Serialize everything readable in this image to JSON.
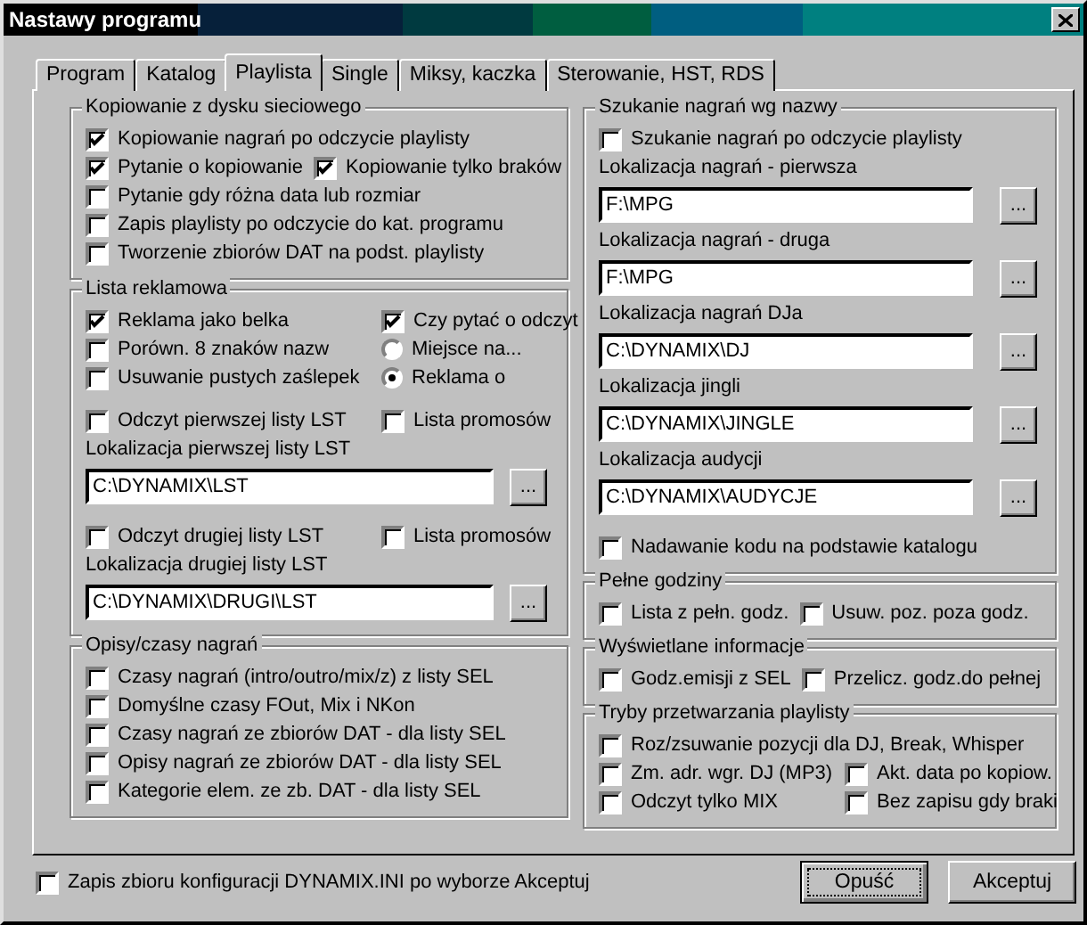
{
  "window": {
    "title": "Nastawy programu"
  },
  "tabs": [
    {
      "label": "Program",
      "selected": false
    },
    {
      "label": "Katalog",
      "selected": false
    },
    {
      "label": "Playlista",
      "selected": true
    },
    {
      "label": "Single",
      "selected": false
    },
    {
      "label": "Miksy, kaczka",
      "selected": false
    },
    {
      "label": "Sterowanie, HST, RDS",
      "selected": false
    }
  ],
  "left_column": [
    {
      "title": "Kopiowanie z dysku sieciowego",
      "items": [
        {
          "kind": "row",
          "cells": [
            {
              "kind": "checkbox",
              "label": "Kopiowanie nagrań po odczycie playlisty",
              "checked": true
            }
          ]
        },
        {
          "kind": "row",
          "cells": [
            {
              "kind": "checkbox",
              "label": "Pytanie o kopiowanie",
              "checked": true
            },
            {
              "kind": "checkbox",
              "label": "Kopiowanie tylko braków",
              "checked": true
            }
          ]
        },
        {
          "kind": "row",
          "cells": [
            {
              "kind": "checkbox",
              "label": "Pytanie gdy różna data lub rozmiar",
              "checked": false
            }
          ]
        },
        {
          "kind": "row",
          "cells": [
            {
              "kind": "checkbox",
              "label": "Zapis playlisty po odczycie do kat. programu",
              "checked": false
            }
          ]
        },
        {
          "kind": "row",
          "cells": [
            {
              "kind": "checkbox",
              "label": "Tworzenie zbiorów DAT na podst. playlisty",
              "checked": false
            }
          ]
        }
      ]
    },
    {
      "title": "Lista reklamowa",
      "items": [
        {
          "kind": "row",
          "cells": [
            {
              "kind": "checkbox",
              "label": "Reklama jako belka",
              "checked": true
            },
            {
              "kind": "checkbox",
              "label": "Czy pytać o odczyt",
              "checked": true
            }
          ]
        },
        {
          "kind": "row",
          "cells": [
            {
              "kind": "checkbox",
              "label": "Porówn. 8 znaków nazw",
              "checked": false
            },
            {
              "kind": "radio",
              "label": "Miejsce na...",
              "selected": false
            }
          ]
        },
        {
          "kind": "row",
          "cells": [
            {
              "kind": "checkbox",
              "label": "Usuwanie pustych zaślepek",
              "checked": false
            },
            {
              "kind": "radio",
              "label": "Reklama o",
              "selected": true
            }
          ]
        },
        {
          "kind": "spacer"
        },
        {
          "kind": "row",
          "cells": [
            {
              "kind": "checkbox",
              "label": "Odczyt pierwszej listy LST",
              "checked": false
            },
            {
              "kind": "checkbox",
              "label": "Lista promosów",
              "checked": false
            }
          ]
        },
        {
          "kind": "label",
          "text": "Lokalizacja pierwszej listy LST"
        },
        {
          "kind": "path",
          "value": "C:\\DYNAMIX\\LST",
          "button": "..."
        },
        {
          "kind": "spacer"
        },
        {
          "kind": "row",
          "cells": [
            {
              "kind": "checkbox",
              "label": "Odczyt drugiej listy LST",
              "checked": false
            },
            {
              "kind": "checkbox",
              "label": "Lista promosów",
              "checked": false
            }
          ]
        },
        {
          "kind": "label",
          "text": "Lokalizacja drugiej listy LST"
        },
        {
          "kind": "path",
          "value": "C:\\DYNAMIX\\DRUGI\\LST",
          "button": "..."
        }
      ]
    },
    {
      "title": "Opisy/czasy nagrań",
      "items": [
        {
          "kind": "row",
          "cells": [
            {
              "kind": "checkbox",
              "label": "Czasy nagrań (intro/outro/mix/z) z listy SEL",
              "checked": false
            }
          ]
        },
        {
          "kind": "row",
          "cells": [
            {
              "kind": "checkbox",
              "label": "Domyślne czasy FOut, Mix i NKon",
              "checked": false
            }
          ]
        },
        {
          "kind": "row",
          "cells": [
            {
              "kind": "checkbox",
              "label": "Czasy nagrań ze zbiorów DAT - dla listy SEL",
              "checked": false
            }
          ]
        },
        {
          "kind": "row",
          "cells": [
            {
              "kind": "checkbox",
              "label": "Opisy nagrań ze zbiorów DAT - dla listy SEL",
              "checked": false
            }
          ]
        },
        {
          "kind": "row",
          "cells": [
            {
              "kind": "checkbox",
              "label": "Kategorie elem. ze zb. DAT - dla listy SEL",
              "checked": false
            }
          ]
        }
      ]
    }
  ],
  "right_column": [
    {
      "title": "Szukanie nagrań wg nazwy",
      "items": [
        {
          "kind": "row",
          "cells": [
            {
              "kind": "checkbox",
              "label": "Szukanie nagrań po odczycie playlisty",
              "checked": false
            }
          ]
        },
        {
          "kind": "label",
          "text": "Lokalizacja nagrań - pierwsza"
        },
        {
          "kind": "path",
          "value": "F:\\MPG",
          "button": "..."
        },
        {
          "kind": "label",
          "text": "Lokalizacja nagrań - druga"
        },
        {
          "kind": "path",
          "value": "F:\\MPG",
          "button": "..."
        },
        {
          "kind": "label",
          "text": "Lokalizacja nagrań DJa"
        },
        {
          "kind": "path",
          "value": "C:\\DYNAMIX\\DJ",
          "button": "..."
        },
        {
          "kind": "label",
          "text": "Lokalizacja jingli"
        },
        {
          "kind": "path",
          "value": "C:\\DYNAMIX\\JINGLE",
          "button": "..."
        },
        {
          "kind": "label",
          "text": "Lokalizacja audycji"
        },
        {
          "kind": "path",
          "value": "C:\\DYNAMIX\\AUDYCJE",
          "button": "..."
        },
        {
          "kind": "spacer"
        },
        {
          "kind": "row",
          "cells": [
            {
              "kind": "checkbox",
              "label": "Nadawanie kodu na podstawie katalogu",
              "checked": false
            }
          ]
        }
      ]
    },
    {
      "title": "Pełne godziny",
      "items": [
        {
          "kind": "row",
          "cells": [
            {
              "kind": "checkbox",
              "label": "Lista z pełn. godz.",
              "checked": false
            },
            {
              "kind": "checkbox",
              "label": "Usuw. poz. poza godz.",
              "checked": false
            }
          ]
        }
      ]
    },
    {
      "title": "Wyświetlane informacje",
      "items": [
        {
          "kind": "row",
          "cells": [
            {
              "kind": "checkbox",
              "label": "Godz.emisji z SEL",
              "checked": false
            },
            {
              "kind": "checkbox",
              "label": "Przelicz. godz.do pełnej",
              "checked": false
            }
          ]
        }
      ]
    },
    {
      "title": "Tryby przetwarzania playlisty",
      "items": [
        {
          "kind": "row",
          "cells": [
            {
              "kind": "checkbox",
              "label": "Roz/zsuwanie pozycji dla DJ, Break, Whisper",
              "checked": false
            }
          ]
        },
        {
          "kind": "row",
          "cells": [
            {
              "kind": "checkbox",
              "label": "Zm. adr. wgr. DJ (MP3)",
              "checked": false
            },
            {
              "kind": "checkbox",
              "label": "Akt. data po kopiow.",
              "checked": false
            }
          ]
        },
        {
          "kind": "row",
          "cells": [
            {
              "kind": "checkbox",
              "label": "Odczyt tylko MIX",
              "checked": false
            },
            {
              "kind": "checkbox",
              "label": "Bez zapisu gdy braki",
              "checked": false
            }
          ]
        }
      ]
    }
  ],
  "footer": {
    "checkbox": {
      "label": "Zapis zbioru konfiguracji DYNAMIX.INI po wyborze Akceptuj",
      "checked": false
    },
    "buttons": [
      {
        "label": "Opuść",
        "focused": true
      },
      {
        "label": "Akceptuj",
        "focused": false
      }
    ]
  }
}
